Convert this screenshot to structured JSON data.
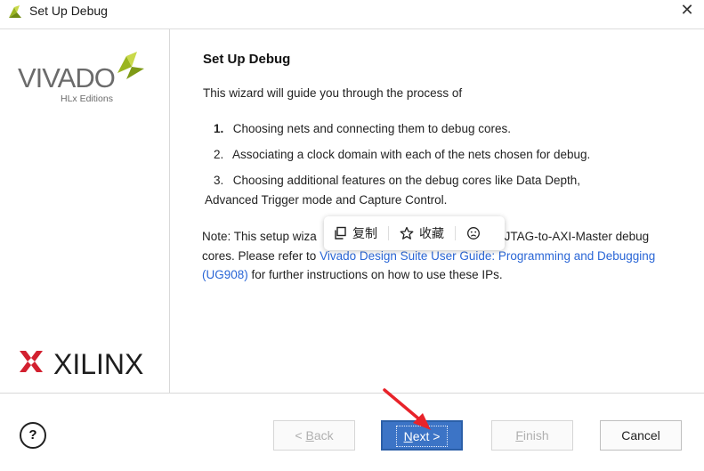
{
  "window": {
    "title": "Set Up Debug",
    "close_glyph": "✕"
  },
  "sidebar": {
    "vivado_logo_text": "VIVADO",
    "vivado_sub_text": "HLx Editions",
    "xilinx_logo_text": "XILINX"
  },
  "content": {
    "heading": "Set Up Debug",
    "intro": "This wizard will guide you through the process of",
    "steps": [
      {
        "num": "1.",
        "text": "Choosing nets and connecting them to debug cores."
      },
      {
        "num": "2.",
        "text": "Associating a clock domain with each of the nets chosen for debug."
      },
      {
        "num": "3.",
        "text": "Choosing additional features on the debug cores like Data Depth,"
      }
    ],
    "step3_cont": "Advanced Trigger mode and Capture Control.",
    "note_prefix": "Note: This setup wiza",
    "note_mid": "IBERT or JTAG-to-AXI-Master debug cores. Please refer to ",
    "note_link": "Vivado Design Suite User Guide: Programming and Debugging (UG908)",
    "note_suffix": " for further instructions on how to use these IPs."
  },
  "popup": {
    "copy_label": "复制",
    "favorite_label": "收藏"
  },
  "buttons": {
    "help": "?",
    "back": "< Back",
    "back_mnemonic": "B",
    "next": "Next >",
    "finish": "Finish",
    "cancel": "Cancel"
  },
  "colors": {
    "link": "#2a66d6",
    "primary_button": "#3c74c6",
    "arrow": "#e8232a",
    "xilinx_red": "#d2202f",
    "vivado_green": "#9ab520"
  }
}
